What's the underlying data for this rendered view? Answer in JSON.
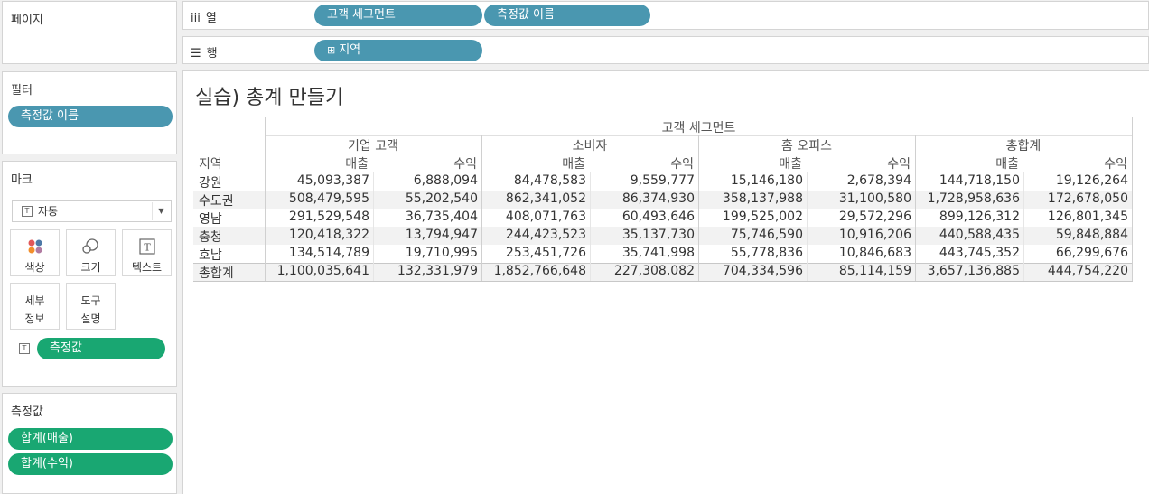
{
  "pages_card": {
    "title": "페이지"
  },
  "columns_shelf": {
    "label": "열",
    "pills": [
      "고객 세그먼트",
      "측정값 이름"
    ]
  },
  "rows_shelf": {
    "label": "행",
    "pills": [
      "지역"
    ]
  },
  "filters_card": {
    "title": "필터",
    "pills": [
      "측정값 이름"
    ]
  },
  "marks_card": {
    "title": "마크",
    "mark_type": "자동",
    "buttons": {
      "color": "색상",
      "size": "크기",
      "text": "텍스트",
      "detail": "세부 정보",
      "tooltip": "도구 설명"
    },
    "field_pill": "측정값"
  },
  "measure_values_card": {
    "title": "측정값",
    "pills": [
      "합계(매출)",
      "합계(수익)"
    ]
  },
  "view": {
    "title": "실습) 총계 만들기",
    "segment_header": "고객 세그먼트",
    "row_header": "지역",
    "segments": [
      "기업 고객",
      "소비자",
      "홈 오피스",
      "총합계"
    ],
    "measures": [
      "매출",
      "수익"
    ],
    "rows": [
      {
        "region": "강원",
        "values": [
          "45,093,387",
          "6,888,094",
          "84,478,583",
          "9,559,777",
          "15,146,180",
          "2,678,394",
          "144,718,150",
          "19,126,264"
        ]
      },
      {
        "region": "수도권",
        "values": [
          "508,479,595",
          "55,202,540",
          "862,341,052",
          "86,374,930",
          "358,137,988",
          "31,100,580",
          "1,728,958,636",
          "172,678,050"
        ]
      },
      {
        "region": "영남",
        "values": [
          "291,529,548",
          "36,735,404",
          "408,071,763",
          "60,493,646",
          "199,525,002",
          "29,572,296",
          "899,126,312",
          "126,801,345"
        ]
      },
      {
        "region": "충청",
        "values": [
          "120,418,322",
          "13,794,947",
          "244,423,523",
          "35,137,730",
          "75,746,590",
          "10,916,206",
          "440,588,435",
          "59,848,884"
        ]
      },
      {
        "region": "호남",
        "values": [
          "134,514,789",
          "19,710,995",
          "253,451,726",
          "35,741,998",
          "55,778,836",
          "10,846,683",
          "443,745,352",
          "66,299,676"
        ]
      },
      {
        "region": "총합계",
        "values": [
          "1,100,035,641",
          "132,331,979",
          "1,852,766,648",
          "227,308,082",
          "704,334,596",
          "85,114,159",
          "3,657,136,885",
          "444,754,220"
        ]
      }
    ]
  }
}
